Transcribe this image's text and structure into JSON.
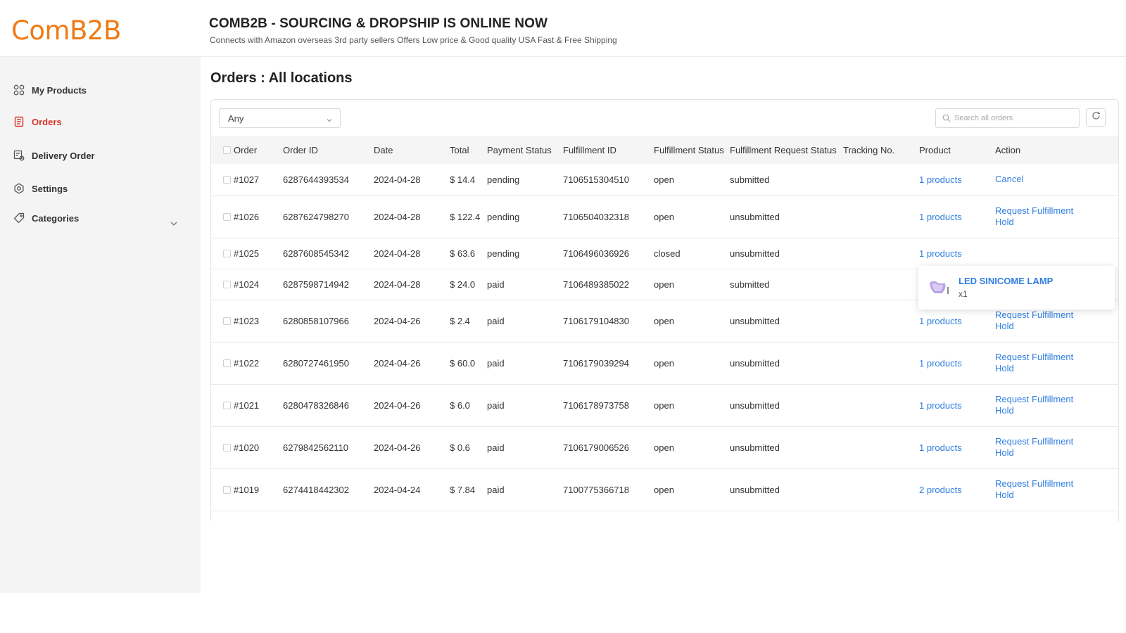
{
  "brand": {
    "logo": "ComB2B",
    "logo_color": "#f07a14"
  },
  "header": {
    "title": "COMB2B - SOURCING & DROPSHIP IS ONLINE NOW",
    "subtitle": "Connects with Amazon overseas 3rd party sellers Offers Low price & Good quality USA Fast & Free Shipping"
  },
  "sidebar": {
    "items": [
      {
        "label": "My Products",
        "icon": "grid-icon"
      },
      {
        "label": "Orders",
        "icon": "clipboard-icon",
        "active": true
      },
      {
        "label": "Delivery Order",
        "icon": "delivery-icon"
      },
      {
        "label": "Settings",
        "icon": "gear-icon"
      },
      {
        "label": "Categories",
        "icon": "tag-icon",
        "expandable": true
      }
    ]
  },
  "main": {
    "title": "Orders : All locations",
    "filter_value": "Any",
    "search_placeholder": "Search all orders",
    "columns": [
      "Order",
      "Order ID",
      "Date",
      "Total",
      "Payment Status",
      "Fulfillment ID",
      "Fulfillment Status",
      "Fulfillment Request Status",
      "Tracking No.",
      "Product",
      "Action"
    ],
    "rows": [
      {
        "order": "#1027",
        "order_id": "6287644393534",
        "date": "2024-04-28",
        "total": "$ 14.4",
        "payment": "pending",
        "fulfillment_id": "7106515304510",
        "f_status": "open",
        "f_request": "submitted",
        "tracking": "",
        "product": "1 products",
        "action": "Cancel"
      },
      {
        "order": "#1026",
        "order_id": "6287624798270",
        "date": "2024-04-28",
        "total": "$ 122.4",
        "payment": "pending",
        "fulfillment_id": "7106504032318",
        "f_status": "open",
        "f_request": "unsubmitted",
        "tracking": "",
        "product": "1 products",
        "action": "Request Fulfillment Hold"
      },
      {
        "order": "#1025",
        "order_id": "6287608545342",
        "date": "2024-04-28",
        "total": "$ 63.6",
        "payment": "pending",
        "fulfillment_id": "7106496036926",
        "f_status": "closed",
        "f_request": "unsubmitted",
        "tracking": "",
        "product": "1 products",
        "action": ""
      },
      {
        "order": "#1024",
        "order_id": "6287598714942",
        "date": "2024-04-28",
        "total": "$ 24.0",
        "payment": "paid",
        "fulfillment_id": "7106489385022",
        "f_status": "open",
        "f_request": "submitted",
        "tracking": "",
        "product": "",
        "action": ""
      },
      {
        "order": "#1023",
        "order_id": "6280858107966",
        "date": "2024-04-26",
        "total": "$ 2.4",
        "payment": "paid",
        "fulfillment_id": "7106179104830",
        "f_status": "open",
        "f_request": "unsubmitted",
        "tracking": "",
        "product": "1 products",
        "action": "Request Fulfillment Hold"
      },
      {
        "order": "#1022",
        "order_id": "6280727461950",
        "date": "2024-04-26",
        "total": "$ 60.0",
        "payment": "paid",
        "fulfillment_id": "7106179039294",
        "f_status": "open",
        "f_request": "unsubmitted",
        "tracking": "",
        "product": "1 products",
        "action": "Request Fulfillment Hold"
      },
      {
        "order": "#1021",
        "order_id": "6280478326846",
        "date": "2024-04-26",
        "total": "$ 6.0",
        "payment": "paid",
        "fulfillment_id": "7106178973758",
        "f_status": "open",
        "f_request": "unsubmitted",
        "tracking": "",
        "product": "1 products",
        "action": "Request Fulfillment Hold"
      },
      {
        "order": "#1020",
        "order_id": "6279842562110",
        "date": "2024-04-26",
        "total": "$ 0.6",
        "payment": "paid",
        "fulfillment_id": "7106179006526",
        "f_status": "open",
        "f_request": "unsubmitted",
        "tracking": "",
        "product": "1 products",
        "action": "Request Fulfillment Hold"
      },
      {
        "order": "#1019",
        "order_id": "6274418442302",
        "date": "2024-04-24",
        "total": "$ 7.84",
        "payment": "paid",
        "fulfillment_id": "7100775366718",
        "f_status": "open",
        "f_request": "unsubmitted",
        "tracking": "",
        "product": "2 products",
        "action": "Request Fulfillment Hold"
      }
    ]
  },
  "popup": {
    "product_name": "LED SINICOME LAMP",
    "quantity": "x1"
  },
  "colors": {
    "accent_red": "#d9362b",
    "link_blue": "#2f7ee0",
    "sidebar_bg": "#f4f4f4"
  }
}
